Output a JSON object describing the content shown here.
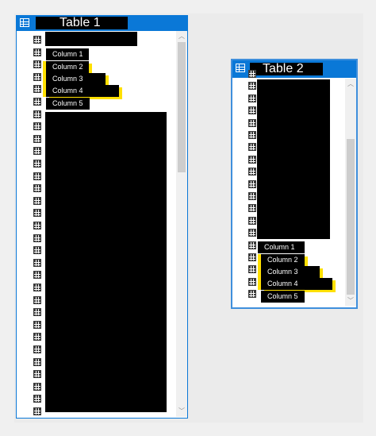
{
  "table1": {
    "title": "Table 1",
    "columns": [
      "Column 1",
      "Column 2",
      "Column 3",
      "Column 4",
      "Column 5"
    ]
  },
  "table2": {
    "title": "Table 2",
    "columns": [
      "Column 1",
      "Column 2",
      "Column 3",
      "Column 4",
      "Column 5"
    ]
  },
  "icons": {
    "table": "table-icon",
    "column": "column-icon",
    "scroll_up": "chevron-up-icon",
    "scroll_down": "chevron-down-icon"
  },
  "colors": {
    "accent": "#0a78d7",
    "highlight": "#ffe000",
    "redaction": "#000000"
  }
}
